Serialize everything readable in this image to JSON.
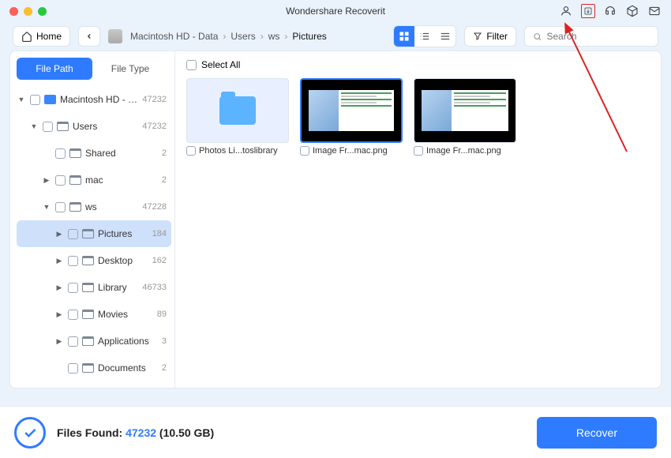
{
  "title": "Wondershare Recoverit",
  "home_label": "Home",
  "breadcrumb": [
    {
      "label": "Macintosh HD - Data",
      "current": false
    },
    {
      "label": "Users",
      "current": false
    },
    {
      "label": "ws",
      "current": false
    },
    {
      "label": "Pictures",
      "current": true
    }
  ],
  "filter_label": "Filter",
  "search_placeholder": "Search",
  "sidebar_tabs": {
    "file_path": "File Path",
    "file_type": "File Type"
  },
  "tree": [
    {
      "indent": 0,
      "icon": "drive",
      "label": "Macintosh HD - Da...",
      "count": "47232",
      "expanded": true
    },
    {
      "indent": 1,
      "icon": "folder",
      "label": "Users",
      "count": "47232",
      "expanded": true
    },
    {
      "indent": 2,
      "icon": "folder",
      "label": "Shared",
      "count": "2",
      "expanded": false,
      "leaf": true
    },
    {
      "indent": 2,
      "icon": "folder",
      "label": "mac",
      "count": "2",
      "expanded": false
    },
    {
      "indent": 2,
      "icon": "folder",
      "label": "ws",
      "count": "47228",
      "expanded": true
    },
    {
      "indent": 3,
      "icon": "folder",
      "label": "Pictures",
      "count": "184",
      "expanded": false,
      "selected": true
    },
    {
      "indent": 3,
      "icon": "folder",
      "label": "Desktop",
      "count": "162",
      "expanded": false
    },
    {
      "indent": 3,
      "icon": "folder",
      "label": "Library",
      "count": "46733",
      "expanded": false
    },
    {
      "indent": 3,
      "icon": "folder",
      "label": "Movies",
      "count": "89",
      "expanded": false
    },
    {
      "indent": 3,
      "icon": "folder",
      "label": "Applications",
      "count": "3",
      "expanded": false
    },
    {
      "indent": 3,
      "icon": "folder",
      "label": "Documents",
      "count": "2",
      "expanded": false,
      "leaf": true
    }
  ],
  "select_all_label": "Select All",
  "thumbnails": [
    {
      "kind": "folder",
      "label": "Photos Li...toslibrary",
      "selected": false
    },
    {
      "kind": "screenshot",
      "label": "Image Fr...mac.png",
      "selected": true
    },
    {
      "kind": "screenshot",
      "label": "Image Fr...mac.png",
      "selected": false
    }
  ],
  "footer": {
    "prefix": "Files Found: ",
    "count": "47232",
    "size": " (10.50 GB)",
    "recover": "Recover"
  }
}
